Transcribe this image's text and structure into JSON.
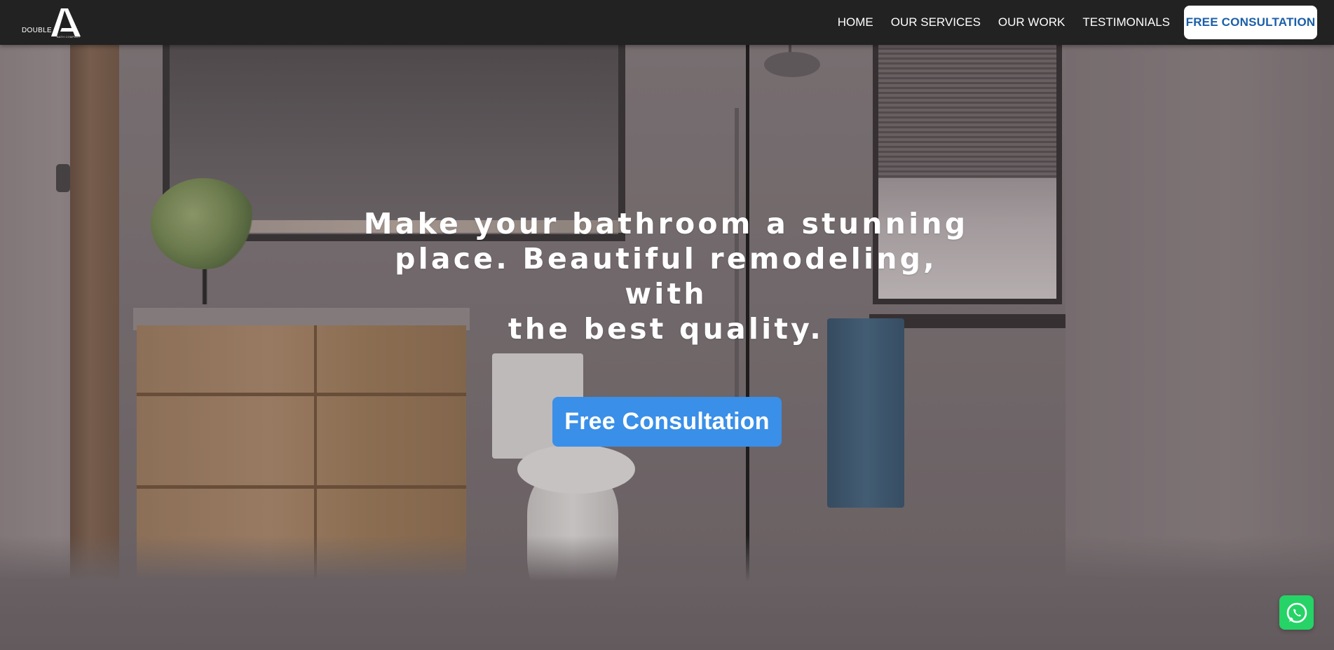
{
  "header": {
    "logo": {
      "text": "DOUBLE",
      "subtext": "BATH COMPANY"
    },
    "nav": [
      {
        "label": "HOME"
      },
      {
        "label": "OUR SERVICES"
      },
      {
        "label": "OUR WORK"
      },
      {
        "label": "TESTIMONIALS"
      }
    ],
    "cta_label": "FREE CONSULTATION"
  },
  "hero": {
    "title_lines": [
      "Make your bathroom a stunning",
      "place. Beautiful remodeling, with",
      "the best quality."
    ],
    "cta_label": "Free Consultation"
  },
  "floating": {
    "icon": "whatsapp-icon"
  },
  "colors": {
    "header_bg": "#222222",
    "nav_cta_text": "#1a5fa8",
    "hero_cta_bg": "#3a8fe8",
    "whatsapp_green": "#25d366"
  }
}
